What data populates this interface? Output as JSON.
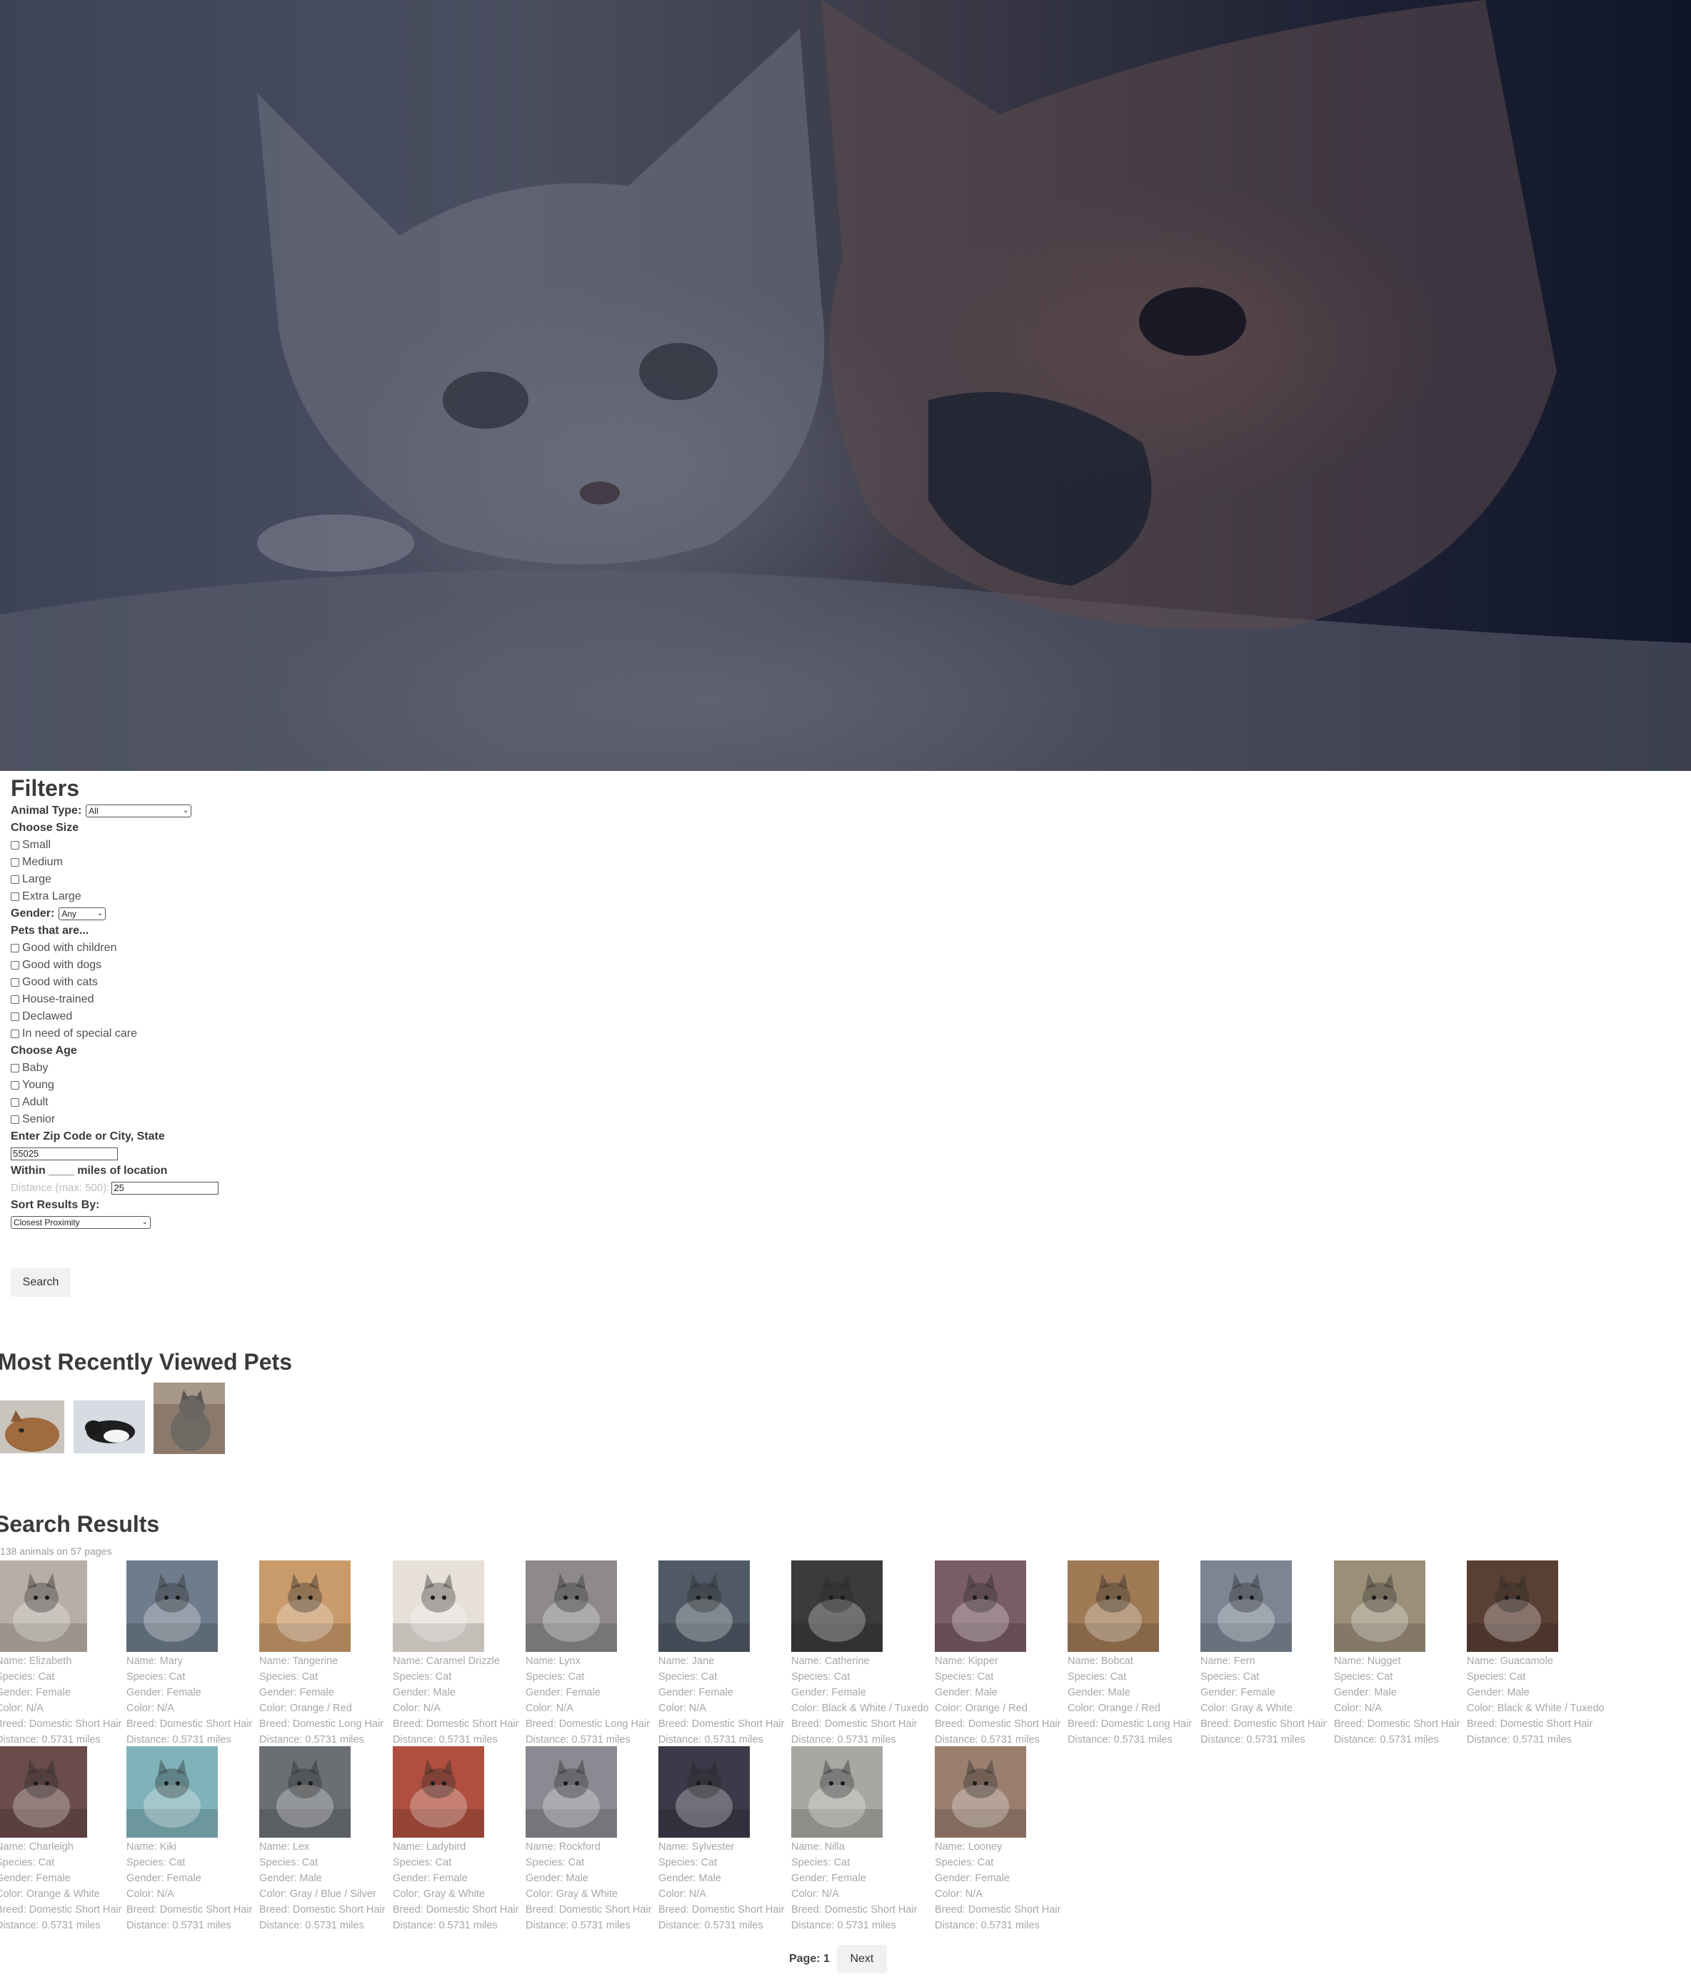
{
  "filters": {
    "title": "Filters",
    "animal_type_label": "Animal Type:",
    "animal_type_value": "All",
    "size_heading": "Choose Size",
    "sizes": [
      "Small",
      "Medium",
      "Large",
      "Extra Large"
    ],
    "gender_label": "Gender:",
    "gender_value": "Any",
    "traits_heading": "Pets that are...",
    "traits": [
      "Good with children",
      "Good with dogs",
      "Good with cats",
      "House-trained",
      "Declawed",
      "In need of special care"
    ],
    "age_heading": "Choose Age",
    "ages": [
      "Baby",
      "Young",
      "Adult",
      "Senior"
    ],
    "location_label": "Enter Zip Code or City, State",
    "location_value": "55025",
    "distance_heading": "Within ____ miles of location",
    "distance_hint": "Distance (max: 500):",
    "distance_value": "25",
    "sort_label": "Sort Results By:",
    "sort_value": "Closest Proximity",
    "search_button": "Search"
  },
  "recent": {
    "title": "Most Recently Viewed Pets"
  },
  "results": {
    "title": "Search Results",
    "count_text": "138 animals on 57 pages",
    "labels": {
      "name": "Name: ",
      "species": "Species: ",
      "gender": "Gender: ",
      "color": "Color: ",
      "breed": "Breed: ",
      "distance": "Distance: "
    },
    "pets": [
      {
        "name": "Elizabeth",
        "species": "Cat",
        "gender": "Female",
        "color": "N/A",
        "breed": "Domestic Short Hair",
        "distance": "0.5731 miles",
        "tone": "#b8aea6"
      },
      {
        "name": "Mary",
        "species": "Cat",
        "gender": "Female",
        "color": "N/A",
        "breed": "Domestic Short Hair",
        "distance": "0.5731 miles",
        "tone": "#6f7c8c"
      },
      {
        "name": "Tangerine",
        "species": "Cat",
        "gender": "Female",
        "color": "Orange / Red",
        "breed": "Domestic Long Hair",
        "distance": "0.5731 miles",
        "tone": "#c99a6a"
      },
      {
        "name": "Caramel Drizzle",
        "species": "Cat",
        "gender": "Male",
        "color": "N/A",
        "breed": "Domestic Short Hair",
        "distance": "0.5731 miles",
        "tone": "#e6e0d8"
      },
      {
        "name": "Lynx",
        "species": "Cat",
        "gender": "Female",
        "color": "N/A",
        "breed": "Domestic Long Hair",
        "distance": "0.5731 miles",
        "tone": "#8e8a8a"
      },
      {
        "name": "Jane",
        "species": "Cat",
        "gender": "Female",
        "color": "N/A",
        "breed": "Domestic Short Hair",
        "distance": "0.5731 miles",
        "tone": "#4f5a66"
      },
      {
        "name": "Catherine",
        "species": "Cat",
        "gender": "Female",
        "color": "Black & White / Tuxedo",
        "breed": "Domestic Short Hair",
        "distance": "0.5731 miles",
        "tone": "#3d3a3a"
      },
      {
        "name": "Kipper",
        "species": "Cat",
        "gender": "Male",
        "color": "Orange / Red",
        "breed": "Domestic Short Hair",
        "distance": "0.5731 miles",
        "tone": "#7a5c66"
      },
      {
        "name": "Bobcat",
        "species": "Cat",
        "gender": "Male",
        "color": "Orange / Red",
        "breed": "Domestic Long Hair",
        "distance": "0.5731 miles",
        "tone": "#a07a55"
      },
      {
        "name": "Fern",
        "species": "Cat",
        "gender": "Female",
        "color": "Gray & White",
        "breed": "Domestic Short Hair",
        "distance": "0.5731 miles",
        "tone": "#7b8594"
      },
      {
        "name": "Nugget",
        "species": "Cat",
        "gender": "Male",
        "color": "N/A",
        "breed": "Domestic Short Hair",
        "distance": "0.5731 miles",
        "tone": "#9b8f78"
      },
      {
        "name": "Guacamole",
        "species": "Cat",
        "gender": "Male",
        "color": "Black & White / Tuxedo",
        "breed": "Domestic Short Hair",
        "distance": "0.5731 miles",
        "tone": "#5a3f34"
      },
      {
        "name": "Charleigh",
        "species": "Cat",
        "gender": "Female",
        "color": "Orange & White",
        "breed": "Domestic Short Hair",
        "distance": "0.5731 miles",
        "tone": "#6a4d4a"
      },
      {
        "name": "Kiki",
        "species": "Cat",
        "gender": "Female",
        "color": "N/A",
        "breed": "Domestic Short Hair",
        "distance": "0.5731 miles",
        "tone": "#7fb3b9"
      },
      {
        "name": "Lex",
        "species": "Cat",
        "gender": "Male",
        "color": "Gray / Blue / Silver",
        "breed": "Domestic Short Hair",
        "distance": "0.5731 miles",
        "tone": "#6b6f74"
      },
      {
        "name": "Ladybird",
        "species": "Cat",
        "gender": "Female",
        "color": "Gray & White",
        "breed": "Domestic Short Hair",
        "distance": "0.5731 miles",
        "tone": "#b04f3f"
      },
      {
        "name": "Rockford",
        "species": "Cat",
        "gender": "Male",
        "color": "Gray & White",
        "breed": "Domestic Short Hair",
        "distance": "0.5731 miles",
        "tone": "#8a8a92"
      },
      {
        "name": "Sylvester",
        "species": "Cat",
        "gender": "Male",
        "color": "N/A",
        "breed": "Domestic Short Hair",
        "distance": "0.5731 miles",
        "tone": "#3a3a48"
      },
      {
        "name": "Nilla",
        "species": "Cat",
        "gender": "Female",
        "color": "N/A",
        "breed": "Domestic Short Hair",
        "distance": "0.5731 miles",
        "tone": "#a7a7a3"
      },
      {
        "name": "Looney",
        "species": "Cat",
        "gender": "Female",
        "color": "N/A",
        "breed": "Domestic Short Hair",
        "distance": "0.5731 miles",
        "tone": "#9a7f6f"
      }
    ]
  },
  "pager": {
    "label": "Page: 1",
    "next": "Next"
  }
}
